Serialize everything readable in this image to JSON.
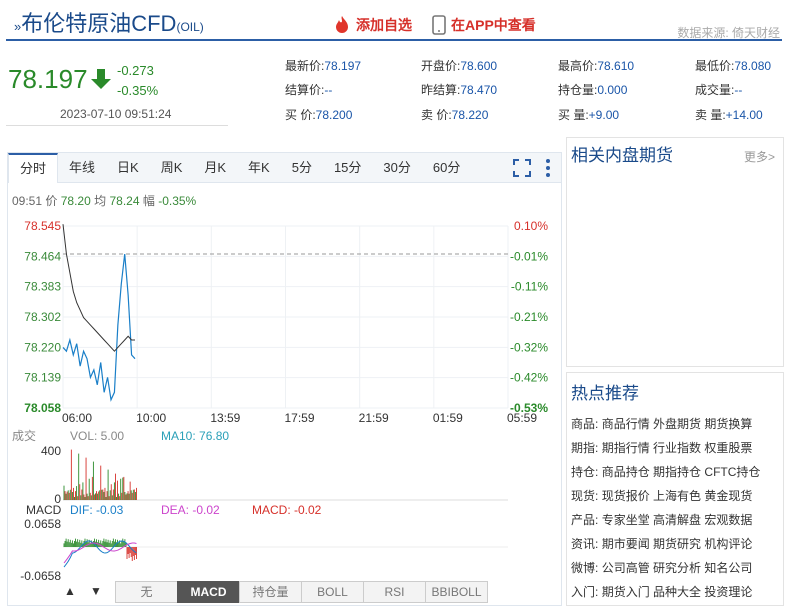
{
  "header": {
    "title_prefix": "»",
    "title": "布伦特原油CFD",
    "code": "(OIL)",
    "add_watch": "添加自选",
    "app_view": "在APP中查看",
    "source": "数据来源: 倚天财经"
  },
  "quote": {
    "price": "78.197",
    "change": "-0.273",
    "change_pct": "-0.35%",
    "datetime": "2023-07-10 09:51:24",
    "fields": [
      [
        "最新价:",
        "78.197"
      ],
      [
        "开盘价:",
        "78.600"
      ],
      [
        "最高价:",
        "78.610"
      ],
      [
        "最低价:",
        "78.080"
      ],
      [
        "结算价:",
        "--"
      ],
      [
        "昨结算:",
        "78.470"
      ],
      [
        "持仓量:",
        "0.000"
      ],
      [
        "成交量:",
        "--"
      ],
      [
        "买 价:",
        "78.200"
      ],
      [
        "卖 价:",
        "78.220"
      ],
      [
        "买 量:",
        "+9.00"
      ],
      [
        "卖 量:",
        "+14.00"
      ]
    ]
  },
  "tabs": [
    "分时",
    "年线",
    "日K",
    "周K",
    "月K",
    "年K",
    "5分",
    "15分",
    "30分",
    "60分"
  ],
  "info": {
    "time": "09:51",
    "price_label": "价",
    "price": "78.20",
    "avg_label": "均",
    "avg": "78.24",
    "range_label": "幅",
    "range": "-0.35%"
  },
  "y_left": [
    "78.545",
    "78.464",
    "78.383",
    "78.302",
    "78.220",
    "78.139",
    "78.058"
  ],
  "y_right": [
    "0.10%",
    "-0.01%",
    "-0.11%",
    "-0.21%",
    "-0.32%",
    "-0.42%",
    "-0.53%"
  ],
  "x_labels": [
    "06:00",
    "10:00",
    "13:59",
    "17:59",
    "21:59",
    "01:59",
    "05:59"
  ],
  "volume": {
    "label": "成交",
    "vol": "VOL: 5.00",
    "ma10": "MA10: 76.80",
    "ymax": "400",
    "ymin": "0"
  },
  "macd": {
    "label": "MACD",
    "dif": "DIF: -0.03",
    "dea": "DEA: -0.02",
    "macd": "MACD: -0.02",
    "ymax": "0.0658",
    "ymin": "-0.0658"
  },
  "bottom_tabs": [
    "无",
    "MACD",
    "持仓量",
    "BOLL",
    "RSI",
    "BBIBOLL"
  ],
  "nav": {
    "up": "▲",
    "down": "▼"
  },
  "colors": {
    "up": "#d6302a",
    "down": "#2a8a2a",
    "price_line": "#1a7fc8",
    "avg_line": "#333333",
    "ma10": "#2aa0b8",
    "dea": "#cc44cc"
  },
  "chart_data": {
    "type": "line",
    "series": [
      {
        "name": "价",
        "values": [
          78.22,
          78.21,
          78.24,
          78.2,
          78.23,
          78.17,
          78.21,
          78.19,
          78.14,
          78.16,
          78.12,
          78.18,
          78.1,
          78.14,
          78.08,
          78.1,
          78.28,
          78.39,
          78.47,
          78.36,
          78.2,
          78.19
        ]
      },
      {
        "name": "均",
        "values": [
          78.55,
          78.47,
          78.42,
          78.37,
          78.34,
          78.32,
          78.3,
          78.29,
          78.28,
          78.27,
          78.26,
          78.25,
          78.24,
          78.23,
          78.22,
          78.21,
          78.22,
          78.23,
          78.24,
          78.25,
          78.24,
          78.24
        ]
      }
    ],
    "ylim": [
      78.058,
      78.545
    ]
  },
  "side": {
    "related_title": "相关内盘期货",
    "more": "更多>",
    "hot_title": "热点推荐",
    "hot_rows": [
      {
        "k": "商品:",
        "v": [
          "商品行情",
          "外盘期货",
          "期货换算"
        ]
      },
      {
        "k": "期指:",
        "v": [
          "期指行情",
          "行业指数",
          "权重股票"
        ]
      },
      {
        "k": "持仓:",
        "v": [
          "商品持仓",
          "期指持仓",
          "CFTC持仓"
        ]
      },
      {
        "k": "现货:",
        "v": [
          "现货报价",
          "上海有色",
          "黄金现货"
        ]
      },
      {
        "k": "产品:",
        "v": [
          "专家坐堂",
          "高清解盘",
          "宏观数据"
        ]
      },
      {
        "k": "资讯:",
        "v": [
          "期市要闻",
          "期货研究",
          "机构评论"
        ]
      },
      {
        "k": "微博:",
        "v": [
          "公司高管",
          "研究分析",
          "知名公司"
        ]
      },
      {
        "k": "入门:",
        "v": [
          "期货入门",
          "品种大全",
          "投资理论"
        ]
      }
    ]
  }
}
